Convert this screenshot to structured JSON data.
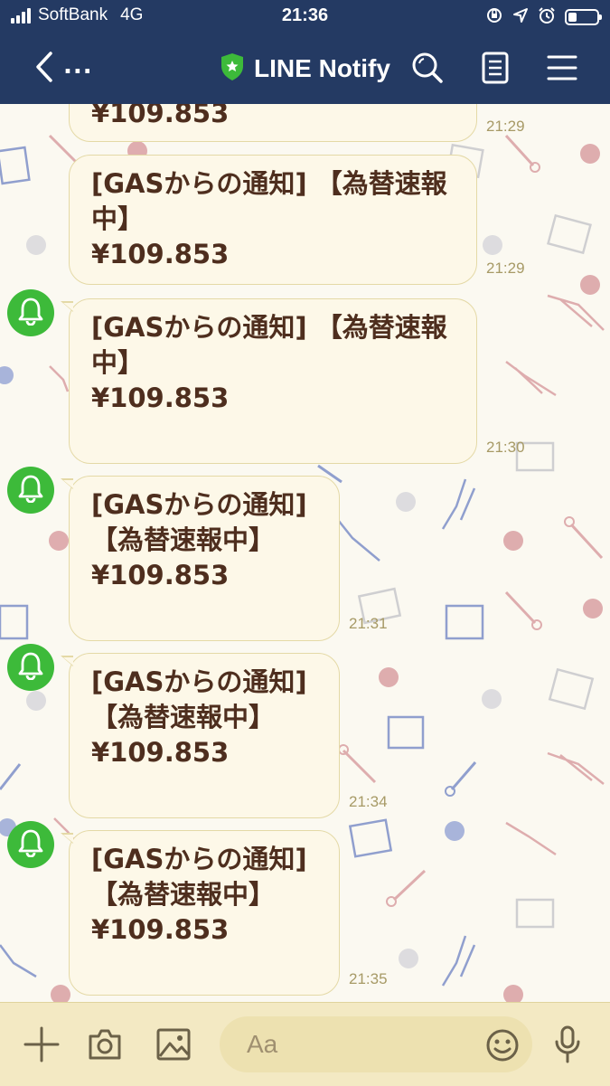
{
  "status_bar": {
    "carrier": "SoftBank",
    "network": "4G",
    "time": "21:36",
    "icons": [
      "signal-icon",
      "rotation-lock-icon",
      "location-icon",
      "alarm-icon",
      "battery-icon"
    ],
    "battery_level": 0.3
  },
  "header": {
    "back_label": "...",
    "title": "LINE Notify",
    "icons": [
      "back-icon",
      "shield-star-icon",
      "search-icon",
      "notes-icon",
      "menu-icon"
    ]
  },
  "messages": [
    {
      "text": "¥109.853",
      "time": "21:29",
      "has_avatar": false
    },
    {
      "text": "[GASからの通知] 【為替速報\n中】\n¥109.853",
      "time": "21:29",
      "has_avatar": false
    },
    {
      "text": "[GASからの通知] 【為替速報\n中】\n¥109.853",
      "time": "21:30",
      "has_avatar": true
    },
    {
      "text": "[GASからの通知]\n【為替速報中】\n¥109.853",
      "time": "21:31",
      "has_avatar": true
    },
    {
      "text": "[GASからの通知]\n【為替速報中】\n¥109.853",
      "time": "21:34",
      "has_avatar": true
    },
    {
      "text": "[GASからの通知]\n【為替速報中】\n¥109.853",
      "time": "21:35",
      "has_avatar": true
    }
  ],
  "input_bar": {
    "placeholder": "Aa",
    "icons": [
      "plus-icon",
      "camera-icon",
      "image-icon",
      "emoji-icon",
      "microphone-icon"
    ]
  },
  "colors": {
    "header_bg": "#243a63",
    "avatar_green": "#3dba3a",
    "bubble_bg": "#fdf8e8",
    "text_brown": "#4e2e1e",
    "input_bar_bg": "#f3e9c3"
  }
}
